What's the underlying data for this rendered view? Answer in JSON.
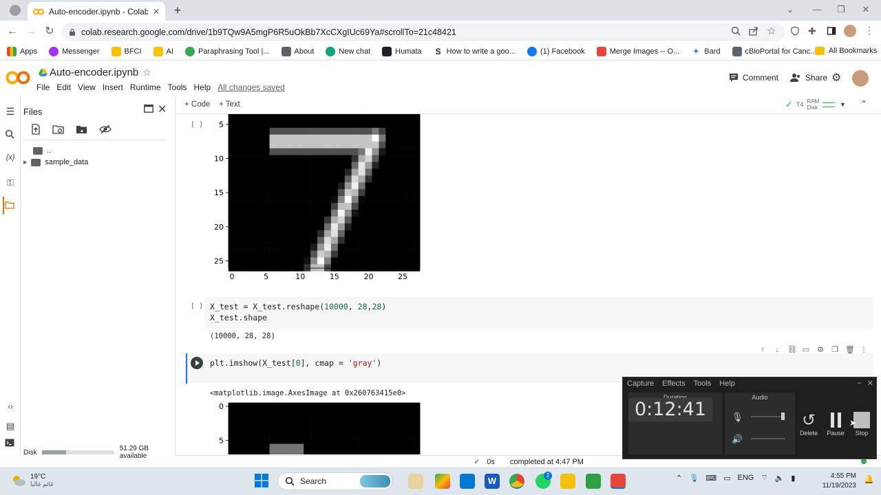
{
  "browser": {
    "tab_title": "Auto-encoder.ipynb - Colaborat",
    "url": "colab.research.google.com/drive/1b9TQw9A5mgP6R5uOkBb7XcCXgIUc69Ya#scrollTo=21c48421",
    "bookmarks": [
      {
        "label": "Apps",
        "color": "#4285f4"
      },
      {
        "label": "Messenger",
        "color": "#a034f0"
      },
      {
        "label": "BFCI",
        "color": "#f4c20d"
      },
      {
        "label": "AI",
        "color": "#f4c20d"
      },
      {
        "label": "Paraphrasing Tool |...",
        "color": "#34a853"
      },
      {
        "label": "About",
        "color": "#5f6368"
      },
      {
        "label": "New chat",
        "color": "#10a37f"
      },
      {
        "label": "Humata",
        "color": "#202124"
      },
      {
        "label": "How to write a goo...",
        "color": "#202124"
      },
      {
        "label": "(1) Facebook",
        "color": "#1877f2"
      },
      {
        "label": "Merge Images -- O...",
        "color": "#e8453c"
      },
      {
        "label": "Bard",
        "color": "#4285f4"
      },
      {
        "label": "cBioPortal for Canc...",
        "color": "#5f6368"
      }
    ],
    "all_bookmarks": "All Bookmarks"
  },
  "colab": {
    "notebook_title": "Auto-encoder.ipynb",
    "menus": [
      "File",
      "Edit",
      "View",
      "Insert",
      "Runtime",
      "Tools",
      "Help"
    ],
    "saved_status": "All changes saved",
    "comment_label": "Comment",
    "share_label": "Share",
    "add_code": "+ Code",
    "add_text": "+ Text",
    "runtime_type": "T4",
    "ram_label": "RAM",
    "disk_label": "Disk"
  },
  "files_panel": {
    "title": "Files",
    "items": [
      {
        "name": ".."
      },
      {
        "name": "sample_data"
      }
    ],
    "disk_label": "Disk",
    "disk_available": "51.29 GB available",
    "disk_used_fraction": 0.33
  },
  "cells": {
    "cell1_bracket": "[ ]",
    "cell2_bracket": "[ ]",
    "cell2_line1_a": "X_test = X_test.reshape(",
    "cell2_line1_n1": "10000",
    "cell2_line1_b": ", ",
    "cell2_line1_n2": "28",
    "cell2_line1_c": ",",
    "cell2_line1_n3": "28",
    "cell2_line1_d": ")",
    "cell2_line2": "X_test.shape",
    "cell2_output": "(10000, 28, 28)",
    "cell3_line_a": "plt.imshow(X_test[",
    "cell3_line_n": "0",
    "cell3_line_b": "], cmap = ",
    "cell3_line_s": "'gray'",
    "cell3_line_c": ")",
    "cell3_output": "<matplotlib.image.AxesImage at 0x260763415e0>"
  },
  "chart_data": [
    {
      "type": "heatmap",
      "title": "",
      "colormap": "gray",
      "x_ticks": [
        0,
        5,
        10,
        15,
        20,
        25
      ],
      "y_ticks_visible": [
        5,
        10,
        15,
        20,
        25
      ],
      "xlim": [
        -0.5,
        27.5
      ],
      "ylim": [
        27.5,
        3.5
      ],
      "content": "handwritten digit 7"
    },
    {
      "type": "heatmap",
      "title": "",
      "colormap": "gray",
      "y_ticks_visible": [
        0,
        5
      ],
      "partially_visible": true
    }
  ],
  "status_bar": {
    "check": "✓",
    "duration": "0s",
    "message": "completed at 4:47 PM"
  },
  "recorder": {
    "menus": [
      "Capture",
      "Effects",
      "Tools",
      "Help"
    ],
    "duration_label": "Duration",
    "audio_label": "Audio",
    "timer": "0:12:41",
    "delete_label": "Delete",
    "pause_label": "Pause",
    "stop_label": "Stop"
  },
  "taskbar": {
    "temperature": "19°C",
    "weather_text": "غائم غالبا",
    "search_label": "Search",
    "language": "ENG",
    "time": "4:55 PM",
    "date": "11/19/2023",
    "whatsapp_badge": "2"
  }
}
